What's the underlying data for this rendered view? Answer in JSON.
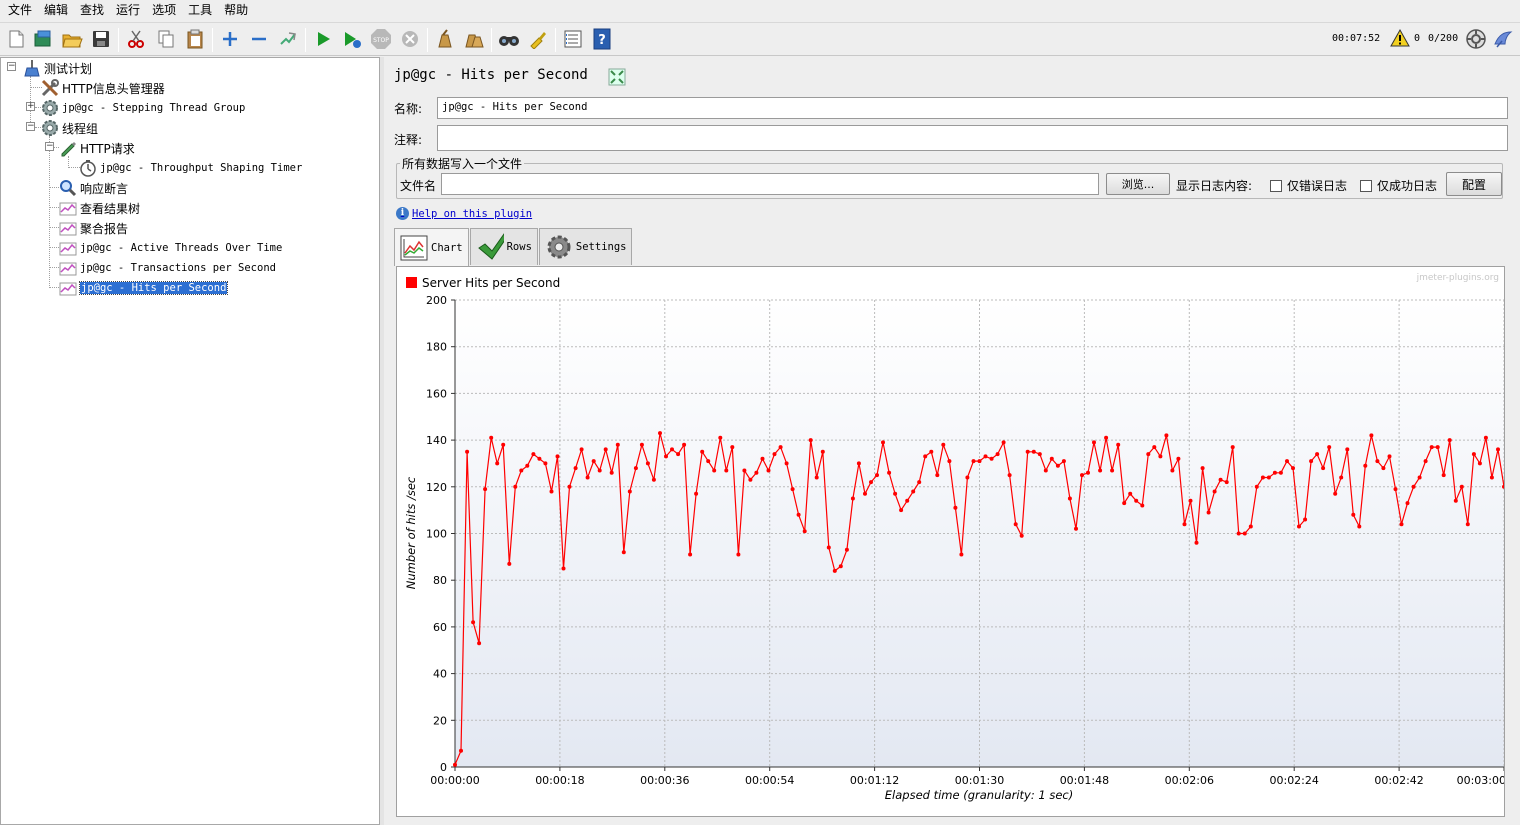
{
  "menu": [
    "文件",
    "编辑",
    "查找",
    "运行",
    "选项",
    "工具",
    "帮助"
  ],
  "toolbar": {
    "buttons": [
      "new-icon",
      "templates-icon",
      "open-icon",
      "save-icon",
      "cut-icon",
      "copy-icon",
      "paste-icon",
      "expand-icon",
      "collapse-icon",
      "toggle-icon",
      "start-icon",
      "start-no-pause-icon",
      "stop-icon",
      "shutdown-icon",
      "clear-icon",
      "clear-all-icon",
      "search-icon",
      "reset-search-icon",
      "function-helper-icon",
      "help-icon"
    ],
    "elapsed_time": "00:07:52",
    "error_count": "0",
    "threads": "0/200"
  },
  "tree": {
    "nodes": [
      {
        "label": "测试计划",
        "icon": "test-plan-icon",
        "mono": false
      },
      {
        "label": "HTTP信息头管理器",
        "icon": "tools-icon",
        "mono": false
      },
      {
        "label": "jp@gc - Stepping Thread Group",
        "icon": "thread-group-gear-icon",
        "mono": true
      },
      {
        "label": "线程组",
        "icon": "thread-group-gear-icon",
        "mono": false
      },
      {
        "label": "HTTP请求",
        "icon": "sampler-pen-icon",
        "mono": false
      },
      {
        "label": "jp@gc - Throughput Shaping Timer",
        "icon": "timer-icon",
        "mono": true
      },
      {
        "label": "响应断言",
        "icon": "magnifier-icon",
        "mono": false
      },
      {
        "label": "查看结果树",
        "icon": "listener-graph-icon",
        "mono": false
      },
      {
        "label": "聚合报告",
        "icon": "listener-graph-icon",
        "mono": false
      },
      {
        "label": "jp@gc - Active Threads Over Time",
        "icon": "listener-graph-icon",
        "mono": true
      },
      {
        "label": "jp@gc - Transactions per Second",
        "icon": "listener-graph-icon",
        "mono": true
      },
      {
        "label": "jp@gc - Hits per Second",
        "icon": "listener-graph-icon",
        "mono": true
      }
    ]
  },
  "panel": {
    "title": "jp@gc - Hits per Second",
    "name_label": "名称:",
    "name_value": "jp@gc - Hits per Second",
    "comment_label": "注释:",
    "comment_value": "",
    "file_group_label": "所有数据写入一个文件",
    "filename_label": "文件名",
    "filename_value": "",
    "browse_label": "浏览...",
    "log_display_label": "显示日志内容:",
    "errors_only_label": "仅错误日志",
    "success_only_label": "仅成功日志",
    "configure_label": "配置",
    "help_link": "Help on this plugin",
    "tabs": [
      {
        "label": "Chart",
        "icon": "chart-icon"
      },
      {
        "label": "Rows",
        "icon": "checkmark-icon"
      },
      {
        "label": "Settings",
        "icon": "gear-icon"
      }
    ]
  },
  "chart_data": {
    "type": "line",
    "credit": "jmeter-plugins.org",
    "legend_position": "top-left",
    "grid": true,
    "xlabel": "Elapsed time (granularity: 1 sec)",
    "ylabel": "Number of hits /sec",
    "xlim": [
      0,
      180
    ],
    "ylim": [
      0,
      200
    ],
    "x_ticks": [
      "00:00:00",
      "00:00:18",
      "00:00:36",
      "00:00:54",
      "00:01:12",
      "00:01:30",
      "00:01:48",
      "00:02:06",
      "00:02:24",
      "00:02:42",
      "00:03:00"
    ],
    "y_ticks": [
      0,
      20,
      40,
      60,
      80,
      100,
      120,
      140,
      160,
      180,
      200
    ],
    "series": [
      {
        "name": "Server Hits per Second",
        "color": "#ff0000",
        "values": [
          1,
          7,
          135,
          62,
          53,
          119,
          141,
          130,
          138,
          87,
          120,
          127,
          129,
          134,
          132,
          130,
          118,
          133,
          85,
          120,
          128,
          136,
          124,
          131,
          127,
          136,
          126,
          138,
          92,
          118,
          128,
          138,
          130,
          123,
          143,
          133,
          136,
          134,
          138,
          91,
          117,
          135,
          131,
          127,
          141,
          127,
          137,
          91,
          127,
          123,
          126,
          132,
          127,
          134,
          137,
          130,
          119,
          108,
          101,
          140,
          124,
          135,
          94,
          84,
          86,
          93,
          115,
          130,
          117,
          122,
          125,
          139,
          126,
          117,
          110,
          114,
          118,
          122,
          133,
          135,
          125,
          138,
          131,
          111,
          91,
          124,
          131,
          131,
          133,
          132,
          134,
          139,
          125,
          104,
          99,
          135,
          135,
          134,
          127,
          132,
          129,
          131,
          115,
          102,
          125,
          126,
          139,
          127,
          141,
          127,
          138,
          113,
          117,
          114,
          112,
          134,
          137,
          133,
          142,
          127,
          132,
          104,
          114,
          96,
          128,
          109,
          118,
          123,
          122,
          137,
          100,
          100,
          103,
          120,
          124,
          124,
          126,
          126,
          131,
          128,
          103,
          106,
          131,
          134,
          128,
          137,
          117,
          124,
          136,
          108,
          103,
          129,
          142,
          131,
          128,
          133,
          119,
          104,
          113,
          120,
          124,
          131,
          137,
          137,
          125,
          140,
          114,
          120,
          104,
          134,
          130,
          141,
          124,
          136,
          120
        ]
      }
    ]
  }
}
